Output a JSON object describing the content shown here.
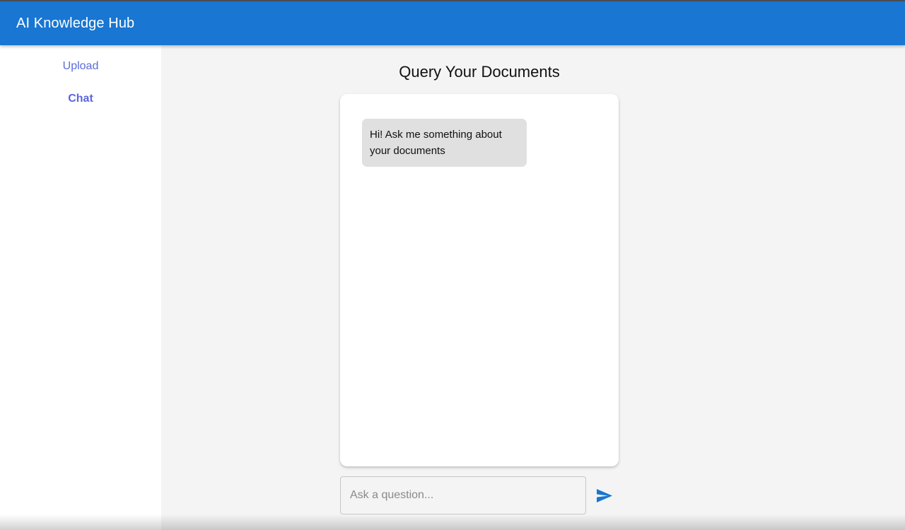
{
  "appbar": {
    "title": "AI Knowledge Hub"
  },
  "sidebar": {
    "items": [
      {
        "label": "Upload",
        "active": false
      },
      {
        "label": "Chat",
        "active": true
      }
    ]
  },
  "main": {
    "title": "Query Your Documents",
    "messages": [
      {
        "sender": "bot",
        "text": "Hi! Ask me something about your documents"
      }
    ],
    "input": {
      "value": "",
      "placeholder": "Ask a question..."
    },
    "send_icon": "send-icon"
  },
  "colors": {
    "appbar": "#1976d2",
    "nav_link": "#5c6bdc",
    "bubble": "#e0e0e0",
    "send": "#1976d2",
    "background": "#f4f4f4"
  }
}
